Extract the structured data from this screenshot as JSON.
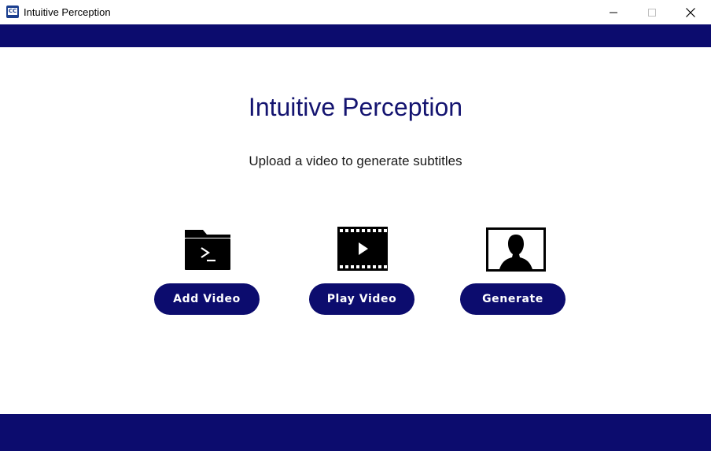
{
  "window": {
    "title": "Intuitive Perception",
    "app_icon_text": "CC",
    "controls": [
      "minimize",
      "maximize",
      "close"
    ]
  },
  "main": {
    "heading": "Intuitive Perception",
    "subtitle": "Upload a video to generate subtitles"
  },
  "actions": [
    {
      "label": "Add  Video",
      "icon": "folder-terminal-icon"
    },
    {
      "label": "Play  Video",
      "icon": "film-play-icon"
    },
    {
      "label": "Generate",
      "icon": "person-silhouette-icon"
    }
  ],
  "colors": {
    "brand_navy": "#0c0c6e",
    "heading": "#141470",
    "background": "#ffffff"
  }
}
